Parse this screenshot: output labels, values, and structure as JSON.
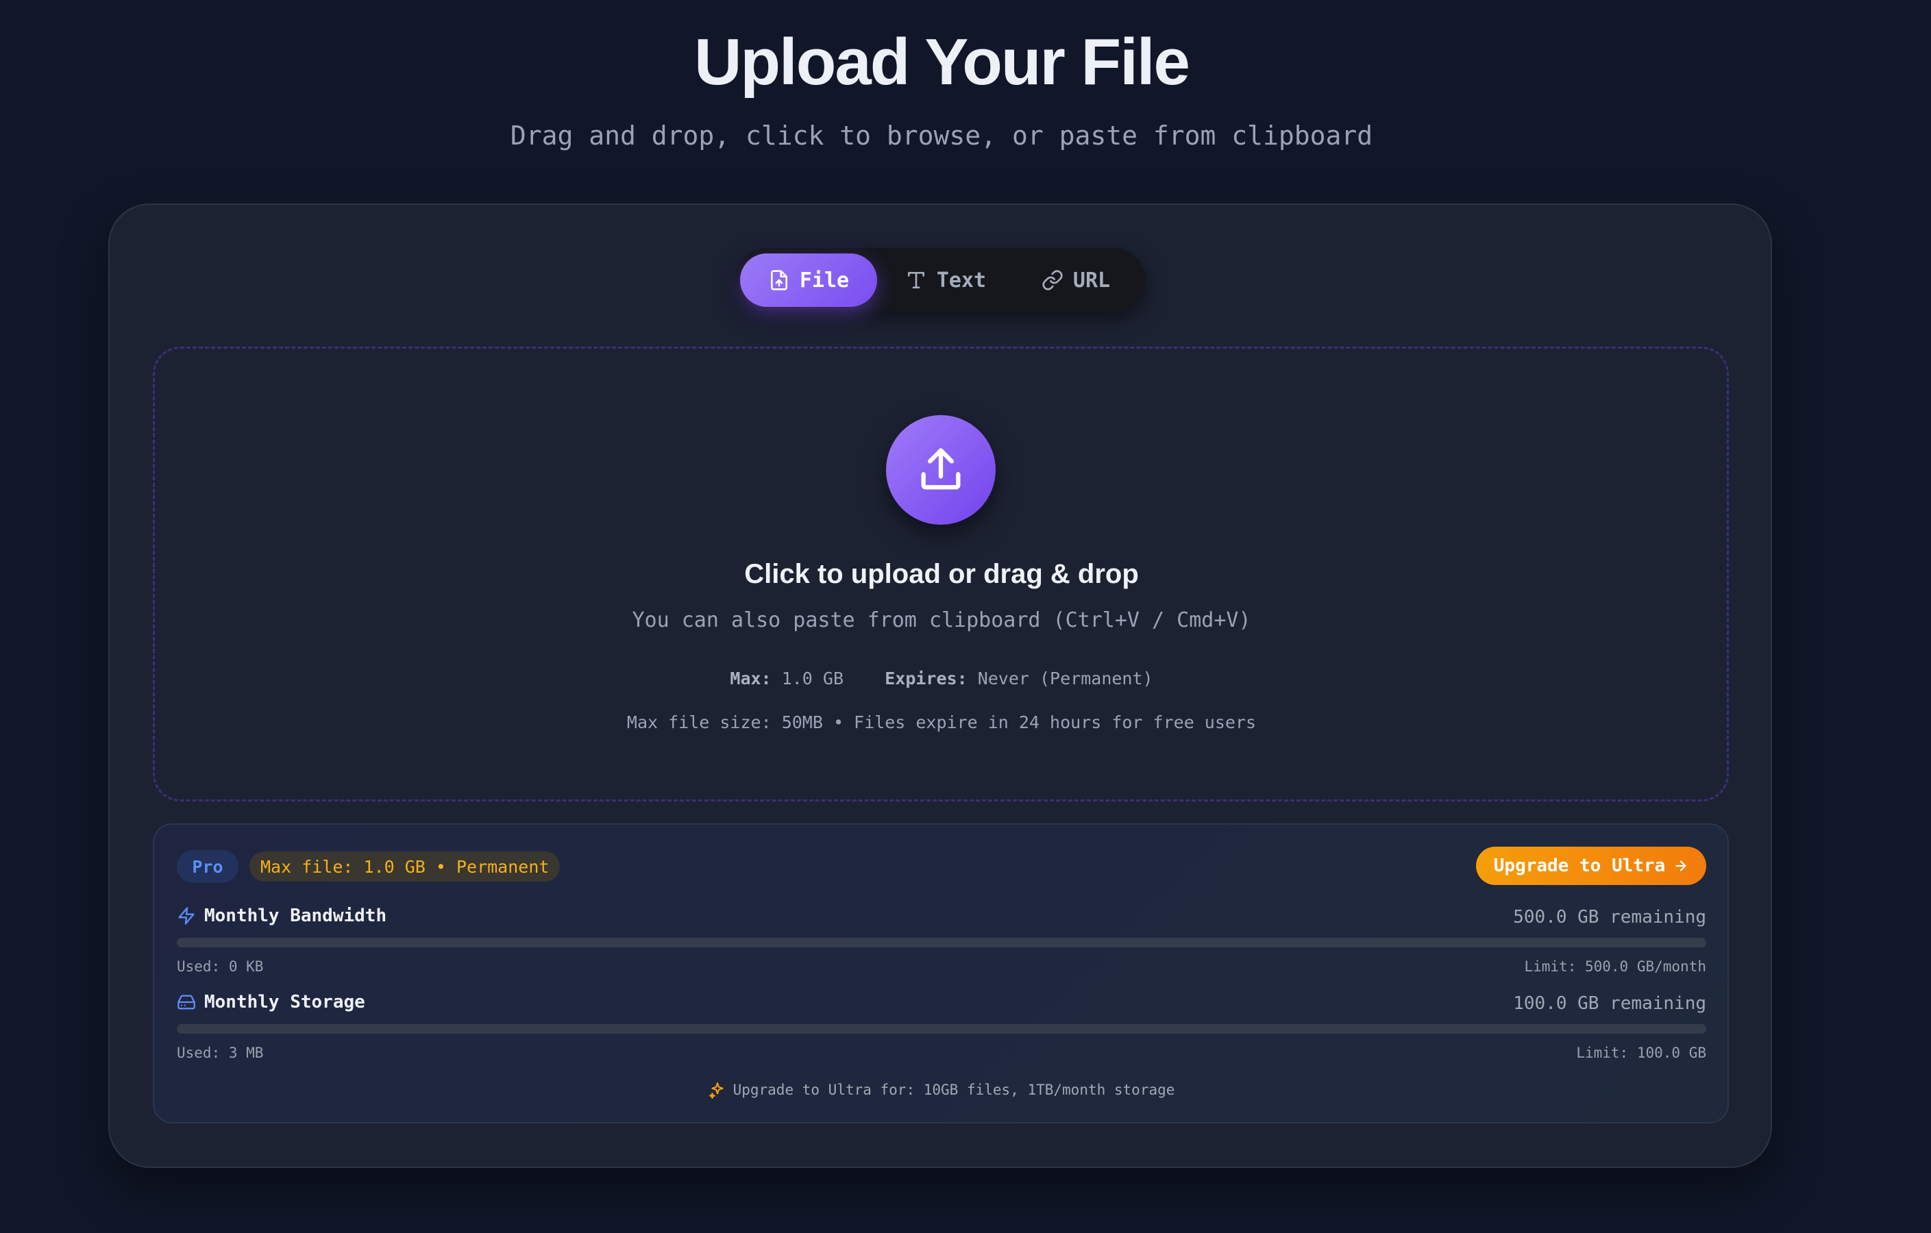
{
  "header": {
    "title": "Upload Your File",
    "subtitle": "Drag and drop, click to browse, or paste from clipboard"
  },
  "tabs": [
    {
      "label": "File",
      "icon": "file-upload-icon",
      "active": true
    },
    {
      "label": "Text",
      "icon": "text-icon",
      "active": false
    },
    {
      "label": "URL",
      "icon": "link-icon",
      "active": false
    }
  ],
  "dropzone": {
    "icon": "upload-icon",
    "title": "Click to upload or drag & drop",
    "subtitle": "You can also paste from clipboard (Ctrl+V / Cmd+V)",
    "max_label": "Max:",
    "max_value": "1.0 GB",
    "expires_label": "Expires:",
    "expires_value": "Never (Permanent)",
    "note": "Max file size: 50MB • Files expire in 24 hours for free users"
  },
  "plan": {
    "tier_badge": "Pro",
    "max_badge": "Max file: 1.0 GB • Permanent",
    "upgrade_button": "Upgrade to Ultra",
    "bandwidth": {
      "label": "Monthly Bandwidth",
      "remaining": "500.0 GB remaining",
      "used": "Used: 0 KB",
      "limit": "Limit: 500.0 GB/month",
      "used_fraction": 0
    },
    "storage": {
      "label": "Monthly Storage",
      "remaining": "100.0 GB remaining",
      "used": "Used: 3 MB",
      "limit": "Limit: 100.0 GB",
      "used_fraction": 3e-05
    },
    "upgrade_note": "Upgrade to Ultra for: 10GB files, 1TB/month storage"
  },
  "colors": {
    "background": "#111729",
    "card": "#1d2233",
    "accent_purple": "#7a4df0",
    "accent_orange": "#f59e0b",
    "pro_blue": "#5d8ef5"
  }
}
